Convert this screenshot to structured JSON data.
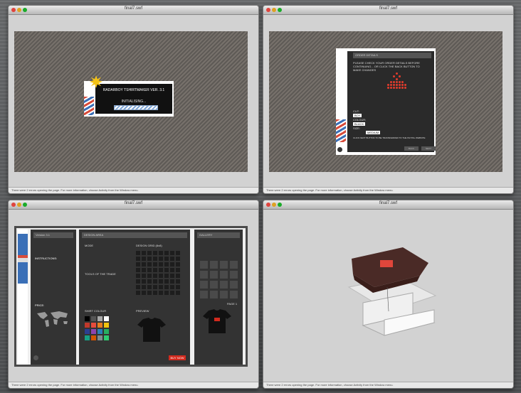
{
  "windows": [
    {
      "title": "final7.swf",
      "status": "There were 2 errors opening the page. For more information, choose Activity from the Window menu."
    },
    {
      "title": "final7.swf",
      "status": "There were 2 errors opening the page. For more information, choose Activity from the Window menu."
    },
    {
      "title": "final7.swf",
      "status": "There were 2 errors opening the page. For more information, choose Activity from the Window menu."
    },
    {
      "title": "final7.swf",
      "status": "There were 2 errors opening the page. For more information, choose Activity from the Window menu."
    }
  ],
  "loader": {
    "heading": "RADARBOY TSHIRTMAKER VER. 3.1",
    "status": "INITIALISING..."
  },
  "order": {
    "header": "ORDER DETAILS",
    "message": "PLEASE CHECK YOUR ORDER DETAILS BEFORE CONTINUING... OR CLICK THE BACK BUTTON TO MAKE CHANGES",
    "cut_label": "CUT:",
    "cut_value": "BOY",
    "colour_label": "COLOUR:",
    "colour_value": "BLACK",
    "size_label": "SIZE:",
    "size_value": "MEDIUM",
    "note": "CLICK NEXT BUTTON TO BE TRANSFERRED TO THE PAYPAL WEBSITE",
    "back_label": "BACK",
    "next_label": "NEXT"
  },
  "designer": {
    "panel1_title": "Version 3.1",
    "instructions_title": "INSTRUCTIONS:",
    "price_title": "PRICE:",
    "panel2_title": "DESIGN AREA",
    "mode_label": "MODE",
    "grid_label": "DESIGN GRID (8x8)",
    "tools_label": "TOOLS OF THE TRADE",
    "shirt_colour_label": "SHIRT COLOUR",
    "preview_label": "PREVIEW",
    "buy_label": "BUY NOW",
    "panel3_title": "GALLERY",
    "page_label": "PAGE 1"
  },
  "colours": {
    "accent_red": "#d22a1e",
    "accent_blue": "#3a6fb7",
    "swatches": [
      "#000000",
      "#555555",
      "#aaaaaa",
      "#ffffff",
      "#c0392b",
      "#e74c3c",
      "#e67e22",
      "#f1c40f",
      "#2c3e91",
      "#8e44ad",
      "#2980b9",
      "#27ae60",
      "#16a085",
      "#d35400",
      "#7f8c8d",
      "#2ecc71"
    ]
  }
}
